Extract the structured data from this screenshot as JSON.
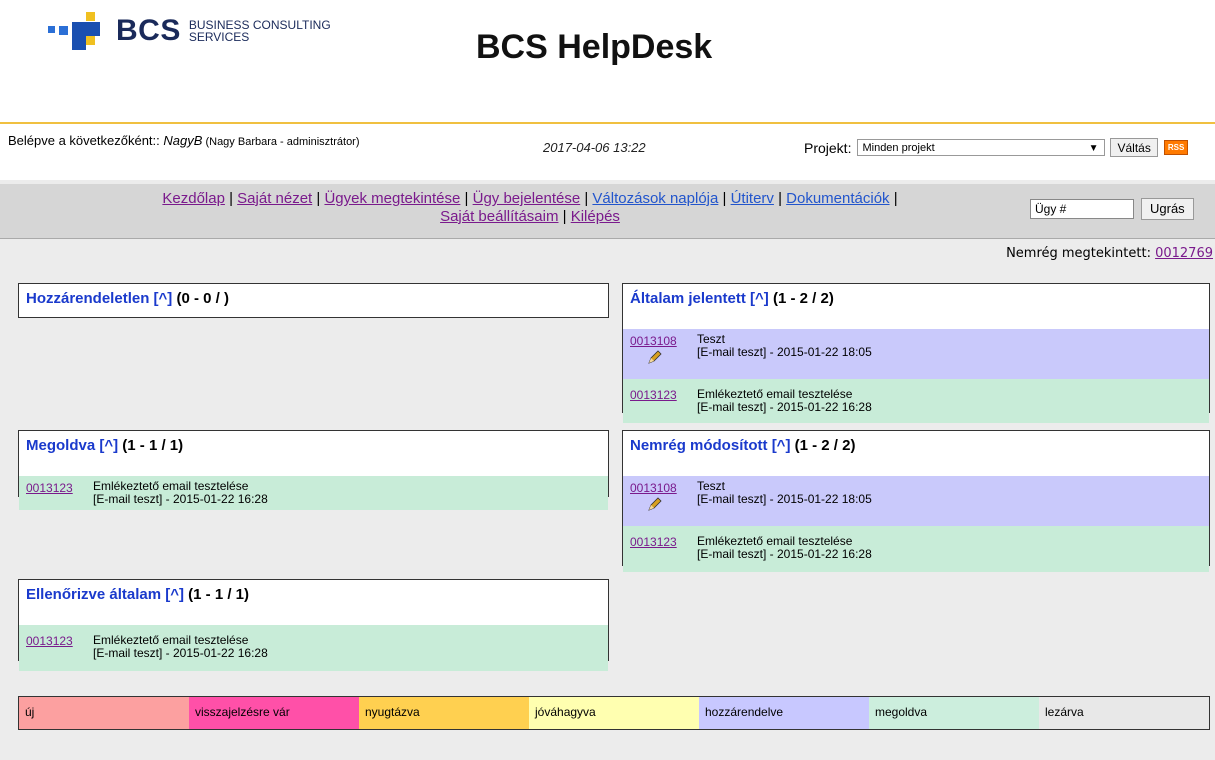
{
  "header": {
    "logo_text": "BCS",
    "logo_sub_line1": "BUSINESS CONSULTING",
    "logo_sub_line2": "SERVICES",
    "app_title": "BCS HelpDesk"
  },
  "userbar": {
    "login_prefix": "Belépve a következőként:: ",
    "username": "NagyB",
    "fullname": " (Nagy Barbara - adminisztrátor)",
    "datetime": "2017-04-06 13:22",
    "project_label": "Projekt:",
    "project_selected": "Minden projekt",
    "switch_button": "Váltás",
    "rss_label": "RSS"
  },
  "nav": {
    "links": [
      {
        "label": "Kezdőlap"
      },
      {
        "label": "Saját nézet"
      },
      {
        "label": "Ügyek megtekintése"
      },
      {
        "label": "Ügy bejelentése"
      },
      {
        "label": "Változások naplója"
      },
      {
        "label": "Útiterv"
      },
      {
        "label": "Dokumentációk"
      },
      {
        "label": "Saját beállításaim"
      },
      {
        "label": "Kilépés"
      }
    ],
    "separator": " | ",
    "issue_input_placeholder": "Ügy #",
    "jump_button": "Ugrás"
  },
  "recent": {
    "label": "Nemrég megtekintett: ",
    "id": "0012769"
  },
  "boxes": {
    "unassigned": {
      "title": "Hozzárendeletlen",
      "toggle": "[^]",
      "count": " (0 - 0 / )"
    },
    "reported": {
      "title": "Általam jelentett",
      "toggle": "[^]",
      "count": " (1 - 2 / 2)",
      "rows": [
        {
          "id": "0013108",
          "summary": "Teszt",
          "meta": "[E-mail teszt] - 2015-01-22 18:05"
        },
        {
          "id": "0013123",
          "summary": "Emlékeztető email tesztelése",
          "meta": "[E-mail teszt] - 2015-01-22 16:28"
        }
      ]
    },
    "resolved": {
      "title": "Megoldva",
      "toggle": "[^]",
      "count": " (1 - 1 / 1)",
      "rows": [
        {
          "id": "0013123",
          "summary": "Emlékeztető email tesztelése",
          "meta": "[E-mail teszt] - 2015-01-22 16:28"
        }
      ]
    },
    "modified": {
      "title": "Nemrég módosított",
      "toggle": "[^]",
      "count": " (1 - 2 / 2)",
      "rows": [
        {
          "id": "0013108",
          "summary": "Teszt",
          "meta": "[E-mail teszt] - 2015-01-22 18:05"
        },
        {
          "id": "0013123",
          "summary": "Emlékeztető email tesztelése",
          "meta": "[E-mail teszt] - 2015-01-22 16:28"
        }
      ]
    },
    "verified": {
      "title": "Ellenőrizve általam",
      "toggle": "[^]",
      "count": " (1 - 1 / 1)",
      "rows": [
        {
          "id": "0013123",
          "summary": "Emlékeztető email tesztelése",
          "meta": "[E-mail teszt] - 2015-01-22 16:28"
        }
      ]
    }
  },
  "legend": [
    {
      "label": "új",
      "color": "#fca0a0"
    },
    {
      "label": "visszajelzésre vár",
      "color": "#ff50a8"
    },
    {
      "label": "nyugtázva",
      "color": "#ffd050"
    },
    {
      "label": "jóváhagyva",
      "color": "#ffffb0"
    },
    {
      "label": "hozzárendelve",
      "color": "#c8c8ff"
    },
    {
      "label": "megoldva",
      "color": "#cceedd"
    },
    {
      "label": "lezárva",
      "color": "#e8e8e8"
    }
  ]
}
